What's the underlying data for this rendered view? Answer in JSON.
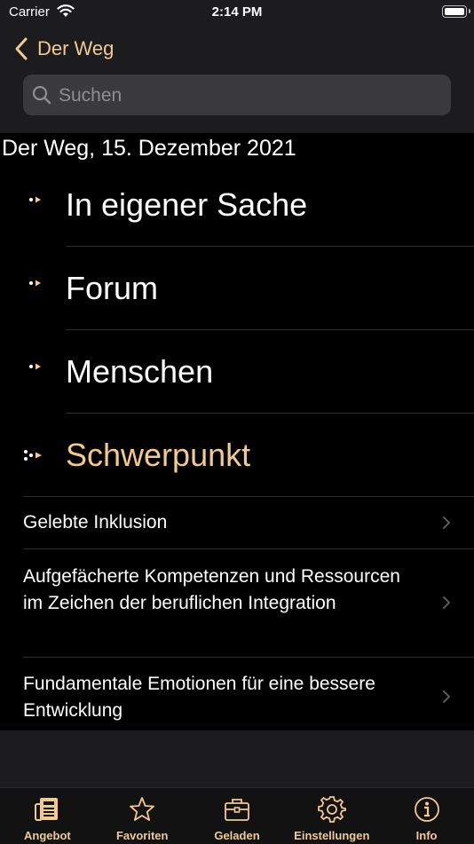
{
  "status": {
    "carrier": "Carrier",
    "time": "2:14 PM"
  },
  "nav": {
    "back_label": "Der Weg",
    "search_placeholder": "Suchen"
  },
  "heading": "Der Weg, 15. Dezember 2021",
  "sections": [
    {
      "title": "In eigener Sache"
    },
    {
      "title": "Forum"
    },
    {
      "title": "Menschen"
    },
    {
      "title": "Schwerpunkt"
    }
  ],
  "articles": [
    {
      "title": "Gelebte Inklusion"
    },
    {
      "title": "Aufgefächerte Kompetenzen und Ressourcen im Zeichen der beruflichen Integration"
    },
    {
      "title": "Fundamentale Emotionen für eine bessere Entwicklung"
    }
  ],
  "tabs": [
    {
      "label": "Angebot",
      "icon": "newspaper-icon"
    },
    {
      "label": "Favoriten",
      "icon": "star-icon"
    },
    {
      "label": "Geladen",
      "icon": "briefcase-icon"
    },
    {
      "label": "Einstellungen",
      "icon": "gear-icon"
    },
    {
      "label": "Info",
      "icon": "info-icon"
    }
  ],
  "colors": {
    "accent": "#f3c98e",
    "bar": "#1c1c1e",
    "background": "#000000",
    "search_field": "#3a3a3c"
  }
}
